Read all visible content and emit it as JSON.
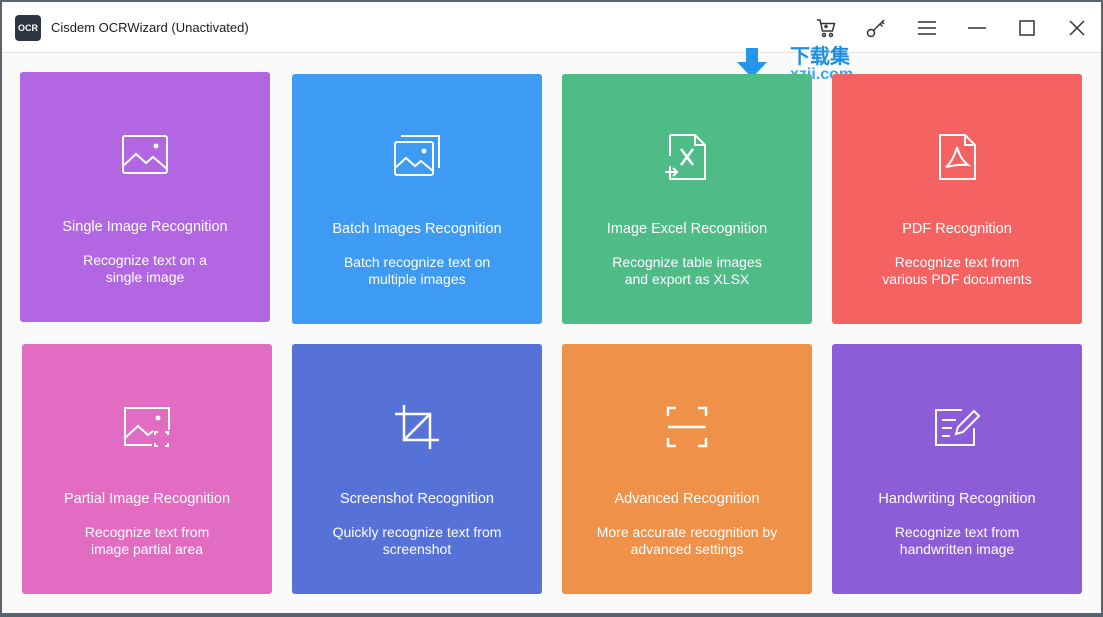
{
  "window": {
    "logo_text": "OCR",
    "title": "Cisdem OCRWizard (Unactivated)"
  },
  "titlebar_icons": [
    "cart-icon",
    "key-icon",
    "menu-icon",
    "minimize-icon",
    "maximize-icon",
    "close-icon"
  ],
  "watermark": {
    "cn": "下载集",
    "en": "xzji.com"
  },
  "cards": [
    {
      "title": "Single Image Recognition",
      "desc": [
        "Recognize text on a",
        "single image"
      ],
      "color": "#b266e2",
      "icon": "image-icon"
    },
    {
      "title": "Batch Images Recognition",
      "desc": [
        "Batch recognize text on",
        "multiple images"
      ],
      "color": "#3e9bf3",
      "icon": "images-stack-icon"
    },
    {
      "title": "Image Excel Recognition",
      "desc": [
        "Recognize table images",
        "and export as XLSX"
      ],
      "color": "#4fbb87",
      "icon": "excel-file-icon"
    },
    {
      "title": "PDF Recognition",
      "desc": [
        "Recognize text from",
        "various PDF documents"
      ],
      "color": "#f46262",
      "icon": "pdf-file-icon"
    },
    {
      "title": "Partial Image Recognition",
      "desc": [
        "Recognize text from",
        "image partial area"
      ],
      "color": "#e26cc2",
      "icon": "partial-image-icon"
    },
    {
      "title": "Screenshot Recognition",
      "desc": [
        "Quickly recognize text from",
        "screenshot"
      ],
      "color": "#5671d8",
      "icon": "crop-icon"
    },
    {
      "title": "Advanced Recognition",
      "desc": [
        "More accurate recognition by",
        "advanced settings"
      ],
      "color": "#f0914a",
      "icon": "scan-frame-icon"
    },
    {
      "title": "Handwriting Recognition",
      "desc": [
        "Recognize text from",
        "handwritten image"
      ],
      "color": "#8d5dd7",
      "icon": "handwriting-icon"
    }
  ]
}
